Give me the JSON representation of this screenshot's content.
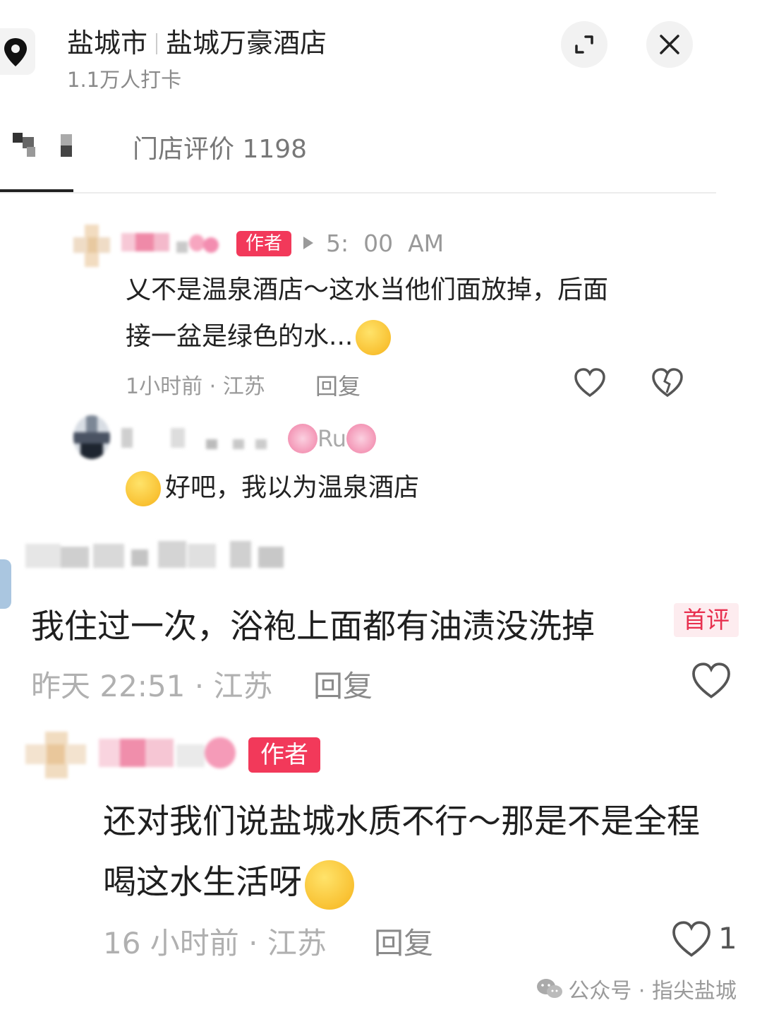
{
  "header": {
    "city": "盐城市",
    "hotel": "盐城万豪酒店",
    "checkins": "1.1万人打卡",
    "expand_icon": "expand-icon",
    "close_icon": "close-icon"
  },
  "tabs": {
    "reviews_label": "门店评价 1198"
  },
  "comments": [
    {
      "badge": "作者",
      "time_inline": "5:  00  AM",
      "text_line1": "乂不是温泉酒店～这水当他们面放掉，后面",
      "text_line2": "接一盆是绿色的水...",
      "meta": "1小时前 · 江苏",
      "reply": "回复"
    },
    {
      "name_suffix": "Ru",
      "text": "好吧，我以为温泉酒店"
    },
    {
      "text": "我住过一次，浴袍上面都有油渍没洗掉",
      "tag": "首评",
      "meta": "昨天 22:51 · 江苏",
      "reply": "回复"
    },
    {
      "badge": "作者",
      "text_line1": "还对我们说盐城水质不行～那是不是全程",
      "text_line2": "喝这水生活呀",
      "meta": "16 小时前 · 江苏",
      "reply": "回复",
      "likes": "1"
    }
  ],
  "watermark": "公众号 · 指尖盐城",
  "colors": {
    "author_badge": "#f2395a",
    "first_tag_text": "#e8304f",
    "first_tag_bg": "#fdecef"
  }
}
